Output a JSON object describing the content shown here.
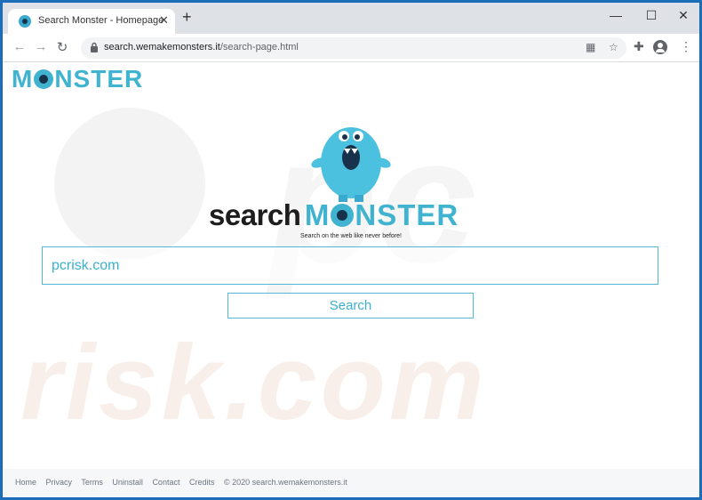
{
  "browser": {
    "tab_title": "Search Monster - Homepage",
    "tab_close": "✕",
    "new_tab": "+",
    "url_host": "search.wemakemonsters.it",
    "url_path": "/search-page.html",
    "window_controls": {
      "minimize": "—",
      "maximize": "☐",
      "close": "✕"
    },
    "nav": {
      "back": "←",
      "forward": "→",
      "reload": "↻"
    },
    "toolbar_icons": {
      "qr": "▦",
      "bookmark": "☆",
      "extensions": "✚",
      "menu": "⋮"
    }
  },
  "page": {
    "corner_logo": {
      "part1": "M",
      "part2": "NSTER"
    },
    "brand": {
      "search": "search",
      "monster_m": "M",
      "monster_rest": "NSTER"
    },
    "tagline": "Search on the web like never before!",
    "search_input_value": "pcrisk.com",
    "search_button_label": "Search",
    "footer_links": [
      "Home",
      "Privacy",
      "Terms",
      "Uninstall",
      "Contact",
      "Credits"
    ],
    "footer_copyright": "© 2020 search.wemakemonsters.it"
  },
  "colors": {
    "accent": "#3fb3cf",
    "dark": "#17324a"
  }
}
